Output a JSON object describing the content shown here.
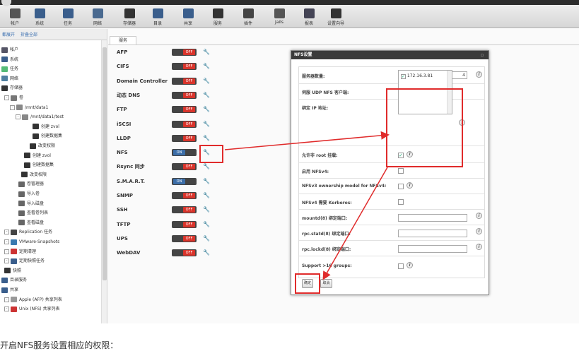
{
  "toolbar": {
    "items": [
      {
        "label": "帐户",
        "icon": "user-icon"
      },
      {
        "label": "系统",
        "icon": "system-icon"
      },
      {
        "label": "任务",
        "icon": "task-icon"
      },
      {
        "label": "网络",
        "icon": "network-icon"
      },
      {
        "label": "存储器",
        "icon": "storage-icon"
      },
      {
        "label": "目录",
        "icon": "directory-icon"
      },
      {
        "label": "共享",
        "icon": "share-icon"
      },
      {
        "label": "服务",
        "icon": "services-icon"
      },
      {
        "label": "插件",
        "icon": "plugins-icon"
      },
      {
        "label": "Jails",
        "icon": "jails-icon"
      },
      {
        "label": "报表",
        "icon": "reports-icon"
      },
      {
        "label": "设置向导",
        "icon": "wizard-icon"
      }
    ]
  },
  "leftpane": {
    "expand_all": "都展开",
    "collapse_all": "折叠全部",
    "tree": [
      "帐户",
      "系统",
      "任务",
      "网络",
      "存储器",
      "卷",
      "/mnt/data1",
      "/mnt/data1/test",
      "创建 zvol",
      "创建数据集",
      "改变权限",
      "创建 zvol",
      "创建数据集",
      "改变权限",
      "卷管理器",
      "导入卷",
      "导入磁盘",
      "查看卷列表",
      "查看磁盘",
      "Replication 任务",
      "VMware-Snapshots",
      "定期清理",
      "定期快照任务",
      "快照",
      "目录服务",
      "共享",
      "Apple (AFP) 共享列表",
      "Unix (NFS) 共享列表"
    ]
  },
  "content": {
    "tab": "服务",
    "services": [
      {
        "name": "AFP",
        "state": "OFF"
      },
      {
        "name": "CIFS",
        "state": "OFF"
      },
      {
        "name": "Domain Controller",
        "state": "OFF"
      },
      {
        "name": "动态 DNS",
        "state": "OFF"
      },
      {
        "name": "FTP",
        "state": "OFF"
      },
      {
        "name": "iSCSI",
        "state": "OFF"
      },
      {
        "name": "LLDP",
        "state": "OFF"
      },
      {
        "name": "NFS",
        "state": "ON"
      },
      {
        "name": "Rsync 同步",
        "state": "OFF"
      },
      {
        "name": "S.M.A.R.T.",
        "state": "ON"
      },
      {
        "name": "SNMP",
        "state": "OFF"
      },
      {
        "name": "SSH",
        "state": "OFF"
      },
      {
        "name": "TFTP",
        "state": "OFF"
      },
      {
        "name": "UPS",
        "state": "OFF"
      },
      {
        "name": "WebDAV",
        "state": "OFF"
      }
    ]
  },
  "dialog": {
    "title": "NFS设置",
    "fields": {
      "servers_label": "服务器数量:",
      "servers_value": "4",
      "udp_label": "伺服 UDP NFS 客户端:",
      "udp_checked": true,
      "bind_ip_label": "绑定 IP 地址:",
      "bind_ip_option": "172.16.3.81",
      "nonroot_label": "允许非 root 挂载:",
      "nonroot_checked": true,
      "nfsv4_label": "启用 NFSv4:",
      "v3owner_label": "NFSv3 ownership model for NFSv4:",
      "kerberos_label": "NFSv4 需要 Kerberos:",
      "mountd_label": "mountd(8) 绑定端口:",
      "statd_label": "rpc.statd(8) 绑定端口:",
      "lockd_label": "rpc.lockd(8) 绑定端口:",
      "groups_label": "Support >16 groups:"
    },
    "ok_button": "确定",
    "cancel_button": "取消"
  },
  "caption": "开启NFS服务设置相应的权限：",
  "colors": {
    "annotation": "#e02b2b",
    "toggle_off": "#d9342b",
    "toggle_on": "#3c6ea8"
  }
}
